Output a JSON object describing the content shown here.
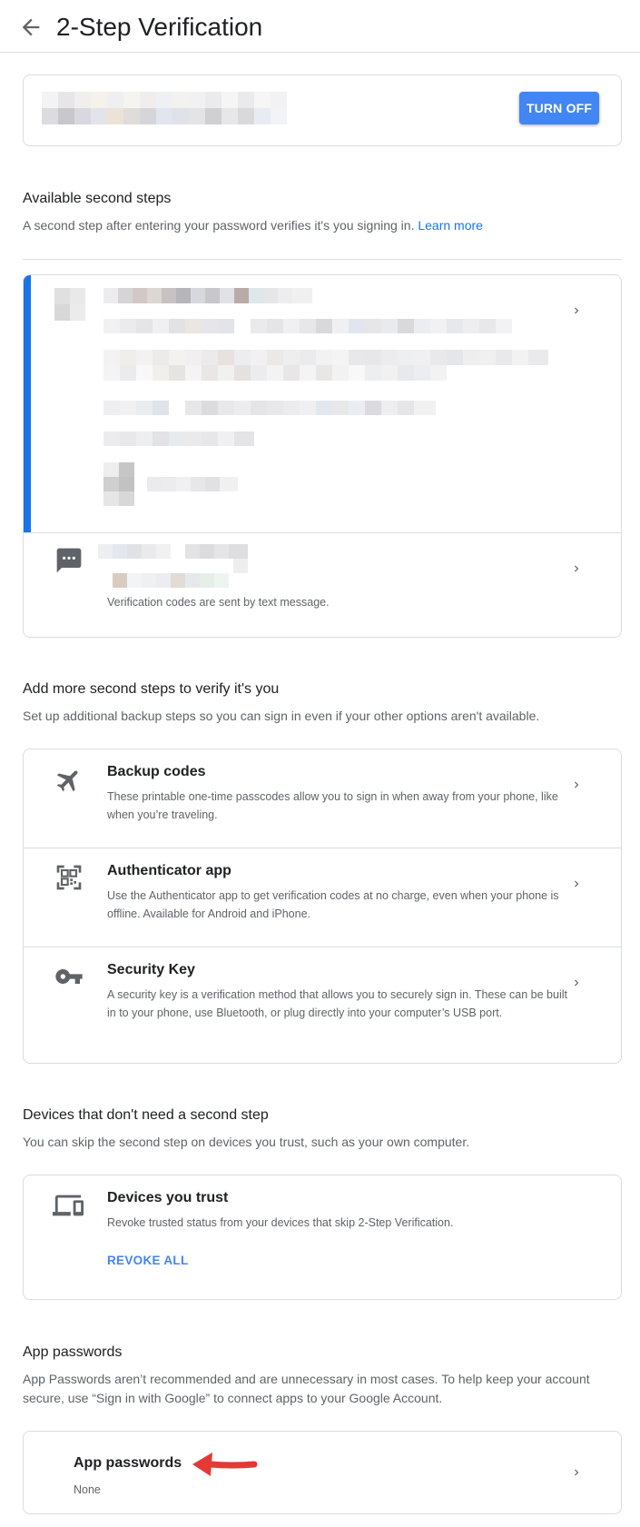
{
  "header": {
    "title": "2-Step Verification",
    "back_icon": "arrow-left-icon"
  },
  "status_card": {
    "turn_off_label": "TURN OFF"
  },
  "available_steps": {
    "title": "Available second steps",
    "description": "A second step after entering your password verifies it's you signing in.",
    "learn_more": "Learn more",
    "text_message_desc": "Verification codes are sent by text message."
  },
  "more_steps": {
    "title": "Add more second steps to verify it's you",
    "description": "Set up additional backup steps so you can sign in even if your other options aren't available.",
    "items": [
      {
        "title": "Backup codes",
        "description": "These printable one-time passcodes allow you to sign in when away from your phone, like when you’re traveling.",
        "icon": "airplane-icon"
      },
      {
        "title": "Authenticator app",
        "description": "Use the Authenticator app to get verification codes at no charge, even when your phone is offline. Available for Android and iPhone.",
        "icon": "qr-code-icon"
      },
      {
        "title": "Security Key",
        "description": "A security key is a verification method that allows you to securely sign in. These can be built in to your phone, use Bluetooth, or plug directly into your computer’s USB port.",
        "icon": "key-icon"
      }
    ]
  },
  "trusted_devices": {
    "title": "Devices that don't need a second step",
    "description": "You can skip the second step on devices you trust, such as your own computer.",
    "card_title": "Devices you trust",
    "card_desc": "Revoke trusted status from your devices that skip 2-Step Verification.",
    "revoke_label": "REVOKE ALL",
    "icon": "devices-icon"
  },
  "app_passwords": {
    "title": "App passwords",
    "description": "App Passwords aren’t recommended and are unnecessary in most cases. To help keep your account secure, use “Sign in with Google” to connect apps to your Google Account.",
    "card_title": "App passwords",
    "card_value": "None"
  },
  "colors": {
    "accent": "#1a73e8",
    "button": "#4285f4",
    "annotation_arrow": "#e53935"
  }
}
